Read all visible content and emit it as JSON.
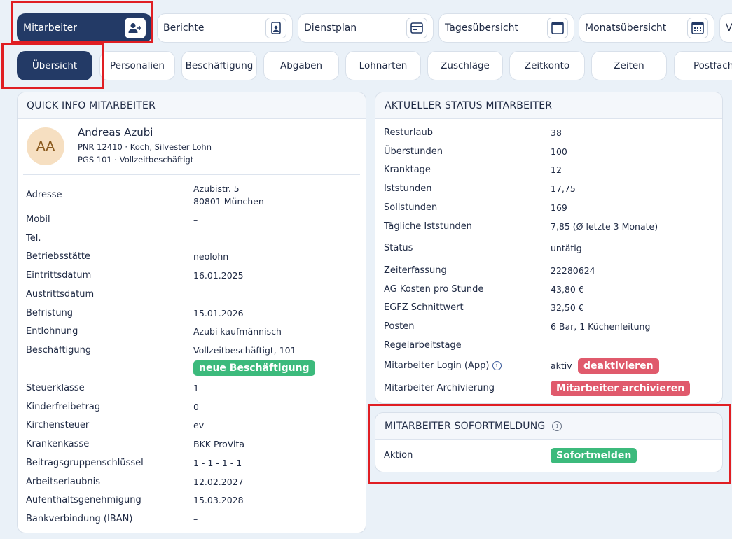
{
  "top_tabs": [
    {
      "label": "Mitarbeiter",
      "icon": "add-user-icon",
      "active": true
    },
    {
      "label": "Berichte",
      "icon": "report-icon"
    },
    {
      "label": "Dienstplan",
      "icon": "schedule-icon"
    },
    {
      "label": "Tagesübersicht",
      "icon": "calendar-day-icon"
    },
    {
      "label": "Monatsübersicht",
      "icon": "calendar-month-icon"
    },
    {
      "label": "V"
    }
  ],
  "sub_tabs": [
    "Übersicht",
    "Personalien",
    "Beschäftigung",
    "Abgaben",
    "Lohnarten",
    "Zuschläge",
    "Zeitkonto",
    "Zeiten",
    "Postfach"
  ],
  "quick_info": {
    "title": "QUICK INFO MITARBEITER",
    "avatar": "AA",
    "name": "Andreas Azubi",
    "line1": "PNR 12410 · Koch, Silvester Lohn",
    "line2": "PGS 101 · Vollzeitbeschäftigt",
    "address_label": "Adresse",
    "address_line1": "Azubistr. 5",
    "address_line2": "80801 München",
    "rows": [
      {
        "label": "Mobil",
        "value": "–"
      },
      {
        "label": "Tel.",
        "value": "–"
      },
      {
        "label": "Betriebsstätte",
        "value": "neolohn"
      },
      {
        "label": "Eintrittsdatum",
        "value": "16.01.2025"
      },
      {
        "label": "Austrittsdatum",
        "value": "–"
      },
      {
        "label": "Befristung",
        "value": "15.01.2026"
      },
      {
        "label": "Entlohnung",
        "value": "Azubi kaufmännisch"
      },
      {
        "label": "Beschäftigung",
        "value": "Vollzeitbeschäftigt, 101"
      }
    ],
    "new_employment_button": "neue Beschäftigung",
    "rows2": [
      {
        "label": "Steuerklasse",
        "value": "1"
      },
      {
        "label": "Kinderfreibetrag",
        "value": "0"
      },
      {
        "label": "Kirchensteuer",
        "value": "ev"
      },
      {
        "label": "Krankenkasse",
        "value": "BKK ProVita"
      },
      {
        "label": "Beitragsgruppenschlüssel",
        "value": "1 - 1 - 1 - 1"
      },
      {
        "label": "Arbeitserlaubnis",
        "value": "12.02.2027"
      },
      {
        "label": "Aufenthaltsgenehmigung",
        "value": "15.03.2028"
      },
      {
        "label": "Bankverbindung (IBAN)",
        "value": "–"
      }
    ]
  },
  "status": {
    "title": "AKTUELLER STATUS MITARBEITER",
    "rows": [
      {
        "label": "Resturlaub",
        "value": "38"
      },
      {
        "label": "Überstunden",
        "value": "100"
      },
      {
        "label": "Kranktage",
        "value": "12"
      },
      {
        "label": "Iststunden",
        "value": "17,75"
      },
      {
        "label": "Sollstunden",
        "value": "169"
      },
      {
        "label": "Tägliche Iststunden",
        "value": "7,85  (Ø letzte 3 Monate)"
      },
      {
        "label": "Status",
        "value": "untätig"
      },
      {
        "label": "Zeiterfassung",
        "value": "22280624"
      },
      {
        "label": "AG Kosten pro Stunde",
        "value": "43,80 €"
      },
      {
        "label": "EGFZ Schnittwert",
        "value": "32,50 €"
      },
      {
        "label": "Posten",
        "value": "6 Bar, 1 Küchenleitung"
      },
      {
        "label": "Regelarbeitstage",
        "value": ""
      }
    ],
    "login_label": "Mitarbeiter Login (App)",
    "login_value": "aktiv",
    "deactivate_button": "deaktivieren",
    "archive_label": "Mitarbeiter Archivierung",
    "archive_button": "Mitarbeiter archivieren"
  },
  "sofort": {
    "title": "MITARBEITER SOFORTMELDUNG",
    "action_label": "Aktion",
    "button": "Sofortmelden"
  }
}
